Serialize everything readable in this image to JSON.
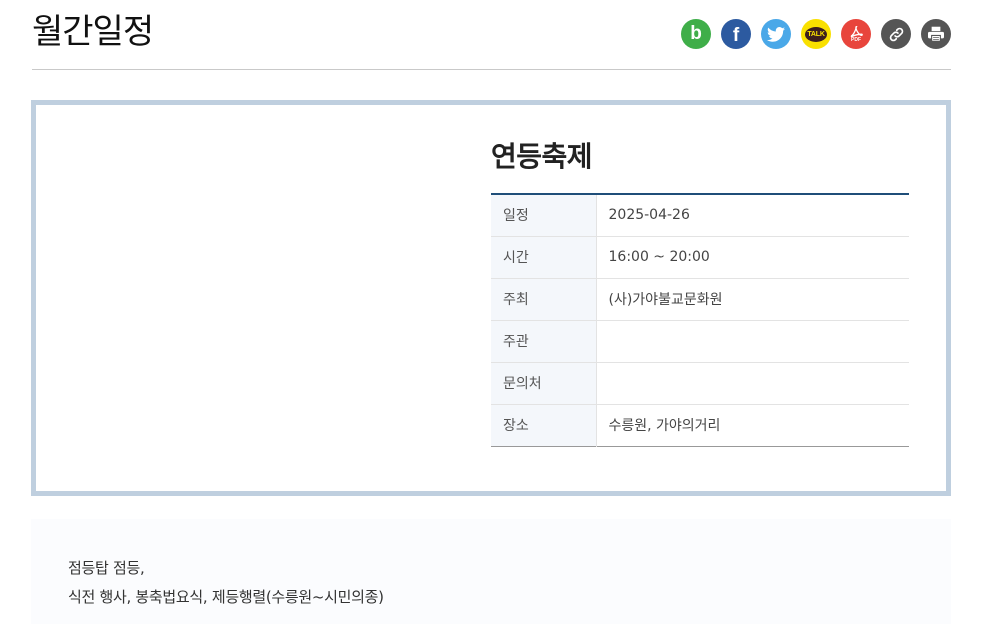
{
  "header": {
    "title": "월간일정"
  },
  "share": {
    "band": {
      "label": "b",
      "color": "#3fae49"
    },
    "facebook": {
      "label": "f",
      "color": "#2c5aa0"
    },
    "twitter": {
      "color": "#4aa8e8"
    },
    "kakaotalk": {
      "label": "TALK",
      "color": "#f9e000"
    },
    "pdf": {
      "label": "PDF",
      "color": "#e8453c"
    },
    "link": {
      "color": "#555555"
    },
    "print": {
      "color": "#555555"
    }
  },
  "event": {
    "title": "연등축제",
    "rows": [
      {
        "key": "일정",
        "value": "2025-04-26"
      },
      {
        "key": "시간",
        "value": "16:00 ~ 20:00"
      },
      {
        "key": "주최",
        "value": "(사)가야불교문화원"
      },
      {
        "key": "주관",
        "value": ""
      },
      {
        "key": "문의처",
        "value": ""
      },
      {
        "key": "장소",
        "value": "수릉원, 가야의거리"
      }
    ]
  },
  "description": {
    "lines": [
      "점등탑 점등,",
      "식전 행사, 봉축법요식, 제등행렬(수릉원~시민의종)"
    ]
  }
}
